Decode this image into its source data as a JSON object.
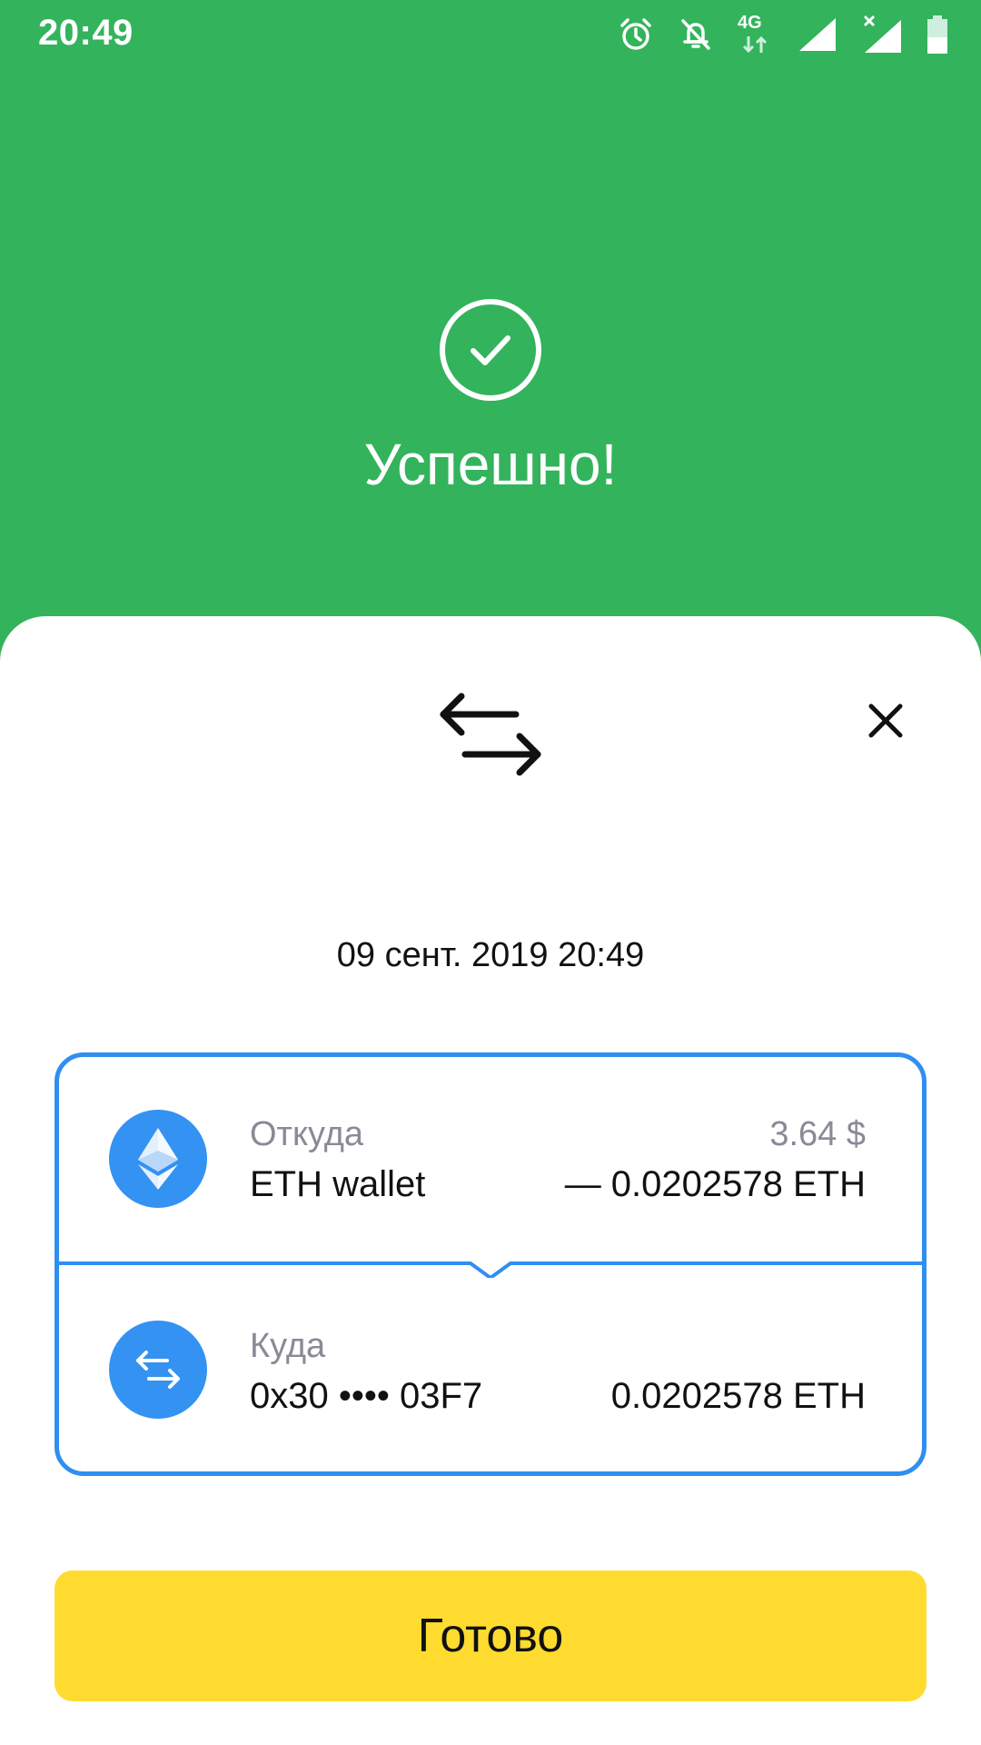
{
  "status_bar": {
    "time": "20:49",
    "icons": [
      "alarm-icon",
      "bell-off-icon",
      "network-4g-icon",
      "signal-icon",
      "signal-no-data-icon",
      "battery-icon"
    ],
    "network_label": "4G"
  },
  "header": {
    "success_icon": "check-circle-icon",
    "title": "Успешно!"
  },
  "sheet": {
    "transfer_icon": "transfer-arrows-icon",
    "close_icon": "close-icon",
    "date": "09 сент. 2019 20:49",
    "from": {
      "label": "Откуда",
      "name": "ETH wallet",
      "fiat": "3.64 $",
      "amount": "— 0.0202578 ETH",
      "icon": "ethereum-icon"
    },
    "to": {
      "label": "Куда",
      "name": "0x30 •••• 03F7",
      "amount": "0.0202578 ETH",
      "icon": "transfer-arrows-icon"
    },
    "done_label": "Готово"
  },
  "colors": {
    "success_green": "#33b35c",
    "card_border": "#2f8ff0",
    "avatar_blue": "#3392f2",
    "done_yellow": "#ffdb30",
    "secondary_text": "#8a8a96"
  }
}
